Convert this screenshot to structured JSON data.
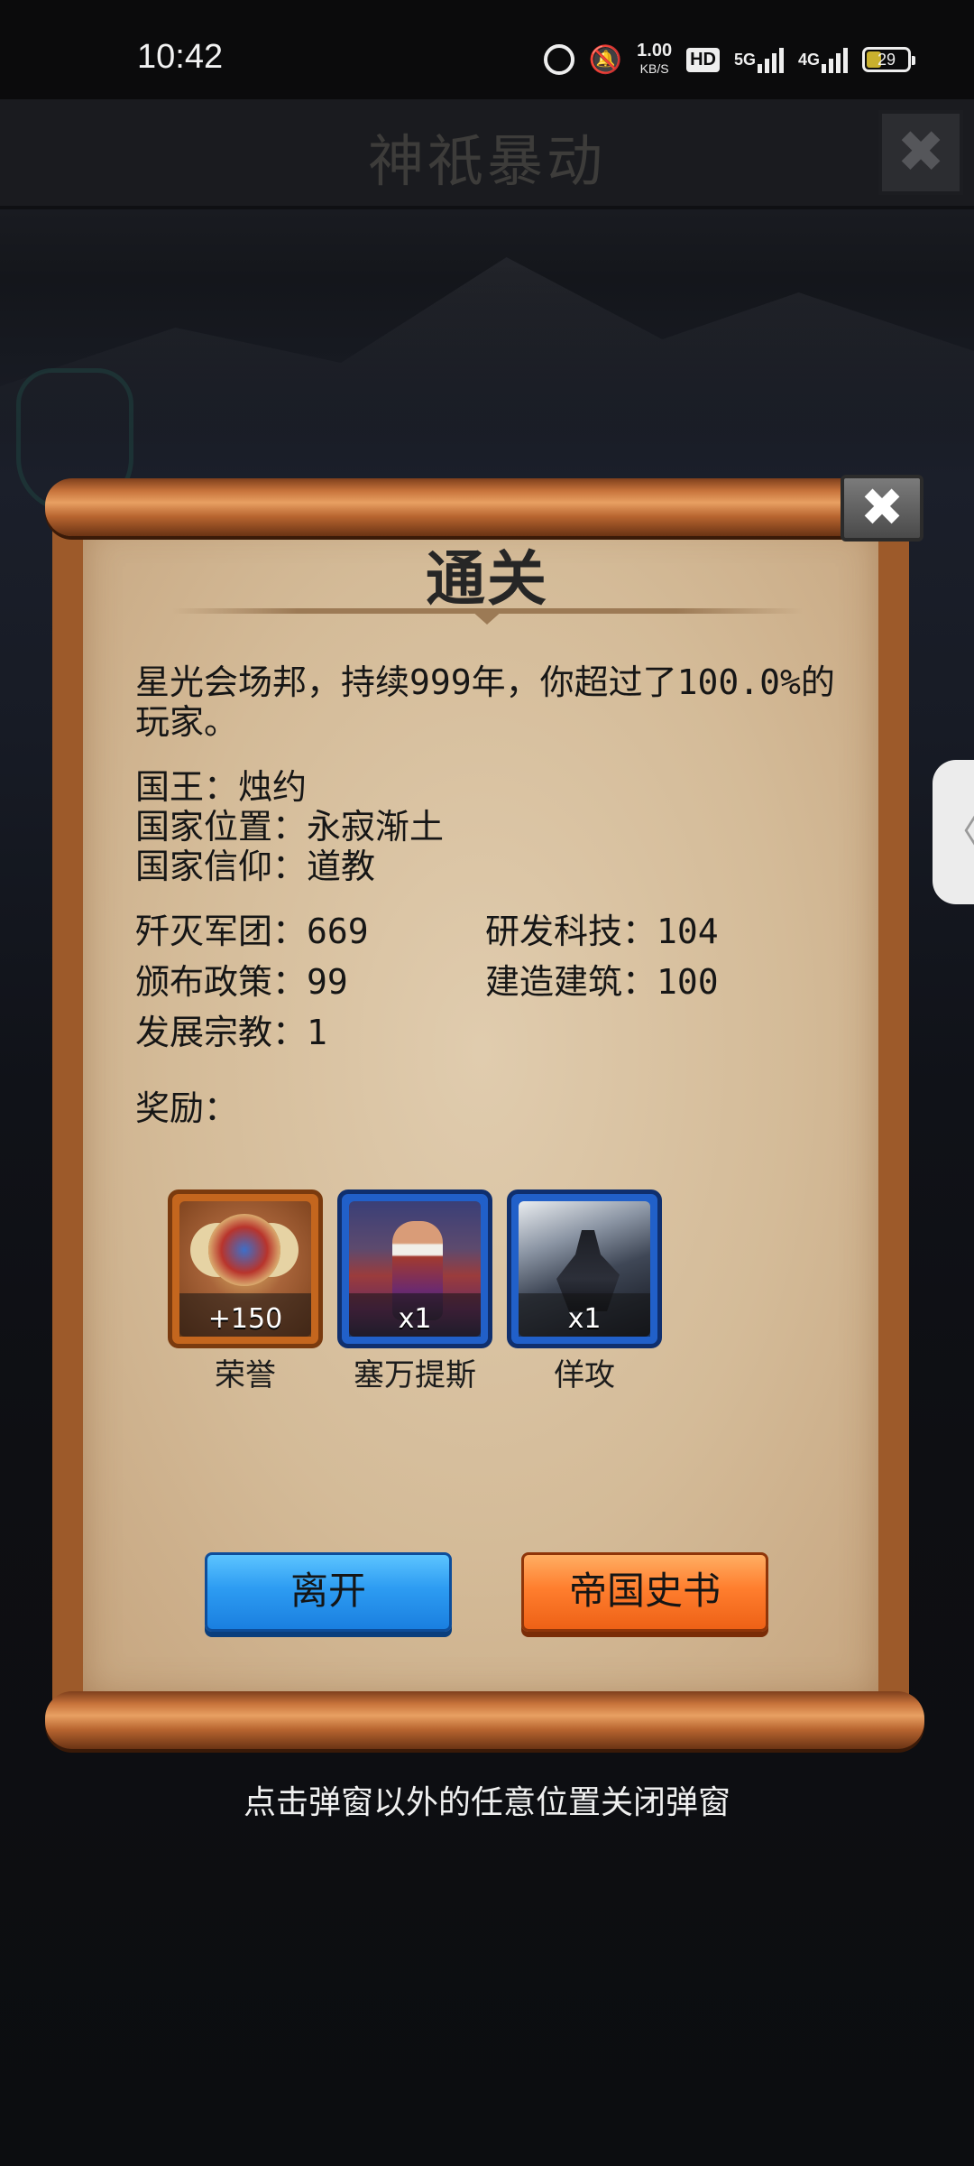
{
  "status_bar": {
    "time": "10:42",
    "net_speed": "1.00",
    "net_speed_unit": "KB/S",
    "hd_badge": "HD",
    "net1": "5G",
    "net2": "4G",
    "battery": "29"
  },
  "background": {
    "title": "神祇暴动",
    "close_glyph": "✖"
  },
  "modal": {
    "title": "通关",
    "close_glyph": "✖",
    "summary": "星光会场邦，持续999年，你超过了100.0%的玩家。",
    "king": "国王：烛约",
    "location": "国家位置：永寂渐土",
    "faith": "国家信仰：道教",
    "stats": {
      "legions": "歼灭军团：669",
      "tech": "研发科技：104",
      "policies": "颁布政策：99",
      "buildings": "建造建筑：100",
      "religion": "发展宗教：1"
    },
    "rewards_label": "奖励：",
    "rewards": [
      {
        "label": "荣誉",
        "qty": "+150",
        "icon": "honor-emblem-icon",
        "frame_color": "#c4661e"
      },
      {
        "label": "塞万提斯",
        "qty": "x1",
        "icon": "cervantes-portrait-icon",
        "frame_color": "#2160c9"
      },
      {
        "label": "佯攻",
        "qty": "x1",
        "icon": "feint-attack-card-icon",
        "frame_color": "#2160c9"
      }
    ],
    "buttons": {
      "leave": "离开",
      "history": "帝国史书"
    }
  },
  "hint": "点击弹窗以外的任意位置关闭弹窗",
  "side_tab_glyph": "〈",
  "colors": {
    "leave_button": "#2d9cf2",
    "history_button": "#ff7e2e",
    "scroll_wood": "#9d5a2a",
    "paper": "#d4bb98"
  }
}
